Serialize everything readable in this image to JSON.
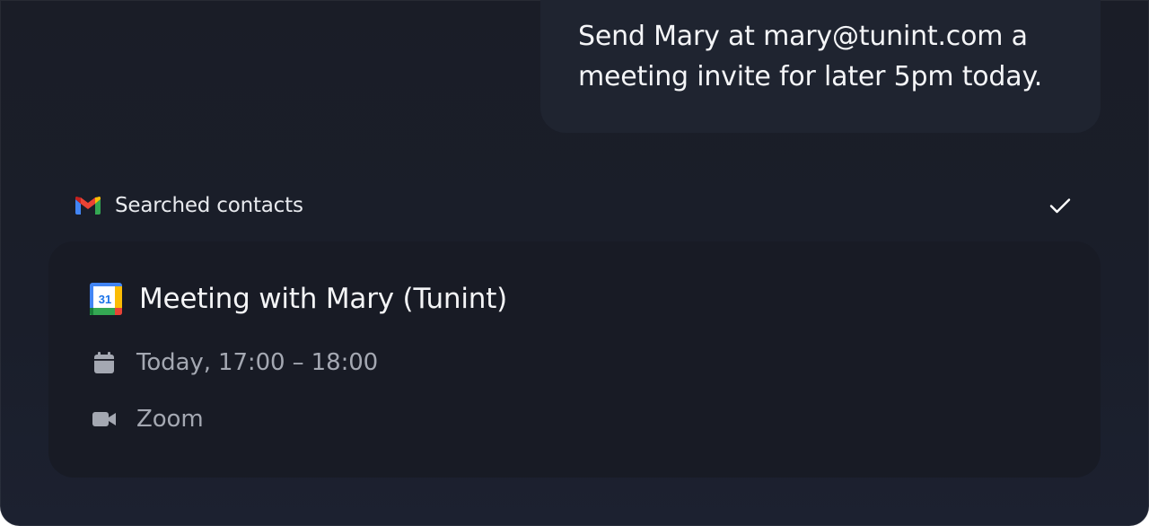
{
  "user_message": {
    "text": "Send Mary at mary@tunint.com a\nmeeting invite for later 5pm today."
  },
  "tool_call": {
    "icon": "gmail-icon",
    "label": "Searched contacts",
    "status_icon": "checkmark-icon"
  },
  "event_card": {
    "icon": "google-calendar-icon",
    "calendar_icon_day": "31",
    "title": "Meeting with Mary (Tunint)",
    "time_icon": "calendar-icon",
    "time": "Today, 17:00 – 18:00",
    "location_icon": "video-camera-icon",
    "location": "Zoom"
  },
  "colors": {
    "background": "#1a1d27",
    "bubble": "#1f2430",
    "card": "#181b25",
    "primary_text": "#f4f5f7",
    "secondary_text": "#a4a8b2"
  }
}
